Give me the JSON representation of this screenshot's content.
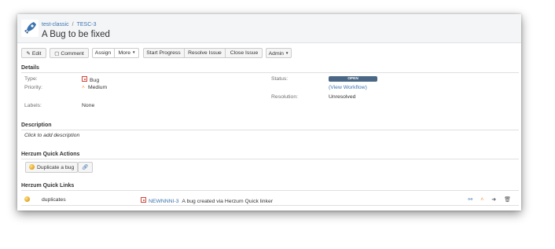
{
  "breadcrumb": {
    "project": "test-classic",
    "issue_key": "TESC-3"
  },
  "issue_title": "A Bug to be fixed",
  "toolbar": {
    "edit": "Edit",
    "comment": "Comment",
    "assign": "Assign",
    "more": "More",
    "start_progress": "Start Progress",
    "resolve_issue": "Resolve Issue",
    "close_issue": "Close Issue",
    "admin": "Admin"
  },
  "details": {
    "section_title": "Details",
    "type_label": "Type:",
    "type_value": "Bug",
    "priority_label": "Priority:",
    "priority_value": "Medium",
    "labels_label": "Labels:",
    "labels_value": "None",
    "status_label": "Status:",
    "status_value": "OPEN",
    "workflow_link": "(View Workflow)",
    "resolution_label": "Resolution:",
    "resolution_value": "Unresolved"
  },
  "description": {
    "section_title": "Description",
    "placeholder": "Click to add description"
  },
  "quick_actions": {
    "section_title": "Herzum Quick Actions",
    "duplicate_label": "Duplicate a bug"
  },
  "quick_links": {
    "section_title": "Herzum Quick Links",
    "rows": [
      {
        "relation": "duplicates",
        "issue_key": "NEWNNNI-3",
        "summary": "A bug created via Herzum Quick linker"
      }
    ]
  },
  "colors": {
    "link": "#3b73af",
    "status_open": "#4a6785",
    "bug_red": "#d04437",
    "priority_orange": "#f79232"
  },
  "icons": {
    "project_logo": "rocket-icon",
    "edit": "pencil-icon",
    "comment": "comment-icon",
    "type": "bug-icon",
    "priority": "priority-medium-icon",
    "quick_action": "coin-icon",
    "link": "link-icon",
    "row_actions": [
      "unlink-icon",
      "priority-icon",
      "transition-icon",
      "delete-icon"
    ]
  }
}
